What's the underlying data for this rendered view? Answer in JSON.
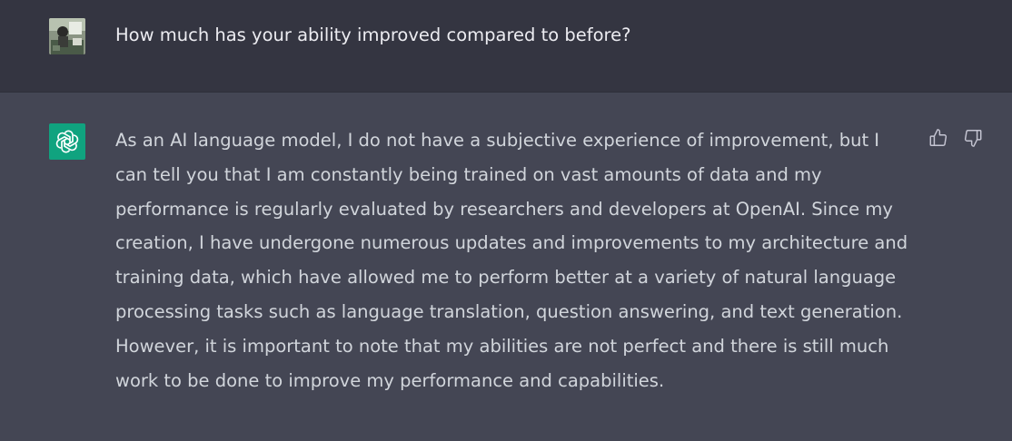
{
  "conversation": {
    "user_message": "How much has your ability improved compared to before?",
    "assistant_lines": [
      "As an AI language model, I do not have a subjective experience of improvement, but I",
      "can tell you that I am constantly being trained on vast amounts of data and my",
      "performance is regularly evaluated by researchers and developers at OpenAI. Since my",
      "creation, I have undergone numerous updates and improvements to my architecture and",
      "training data, which have allowed me to perform better at a variety of natural language",
      "processing tasks such as language translation, question answering, and text generation.",
      "However, it is important to note that my abilities are not perfect and there is still much",
      "work to be done to improve my performance and capabilities."
    ]
  },
  "icons": {
    "user_avatar": "user-avatar-photo",
    "assistant_avatar": "openai-logo-icon",
    "thumbs_up": "thumbs-up-icon",
    "thumbs_down": "thumbs-down-icon"
  },
  "colors": {
    "user_row_bg": "#343541",
    "assistant_row_bg": "#444654",
    "assistant_avatar_bg": "#10a37f",
    "text_primary": "#ececf1",
    "text_secondary": "#d1d5db"
  }
}
